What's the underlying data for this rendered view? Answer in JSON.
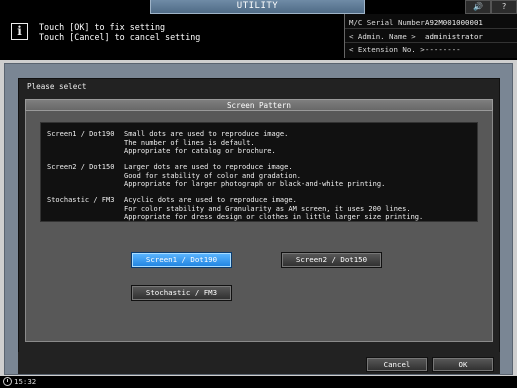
{
  "header": {
    "tab_title": "UTILITY",
    "volume_glyph": "🔊",
    "help_glyph": "?",
    "message_line1": "Touch [OK] to fix setting",
    "message_line2": "Touch [Cancel] to cancel setting"
  },
  "serial_panel": {
    "serial_label": "M/C Serial Number",
    "serial_value": "A92M001000001",
    "admin_label": "< Admin. Name >",
    "admin_value": "administrator",
    "extension_label": "< Extension No. >",
    "extension_value": "--------"
  },
  "dialog": {
    "prompt": "Please select",
    "section_title": "Screen Pattern",
    "descriptions": [
      {
        "name": "Screen1 / Dot190",
        "lines": [
          "Small dots are used to reproduce image.",
          "The number of lines is default.",
          "Appropriate for catalog or brochure."
        ]
      },
      {
        "name": "Screen2 / Dot150",
        "lines": [
          "Larger dots are used to reproduce image.",
          "Good for stability of color and gradation.",
          "Appropriate for larger photograph or black-and-white printing."
        ]
      },
      {
        "name": "Stochastic / FM3",
        "lines": [
          "Acyclic dots are used to reproduce image.",
          "For color stability and Granularity as AM screen, it uses 200 lines.",
          "Appropriate for dress design or clothes in little larger size printing."
        ]
      }
    ],
    "options": {
      "screen1": "Screen1 / Dot190",
      "screen2": "Screen2 / Dot150",
      "stochastic": "Stochastic / FM3"
    },
    "selected_option": "Screen1 / Dot190",
    "cancel_label": "Cancel",
    "ok_label": "OK"
  },
  "status": {
    "time": "15:32"
  },
  "colors": {
    "selected_button": "#1e82e0",
    "frame": "#7a8694",
    "header_tab": "#5b7792"
  },
  "icons": [
    "info-icon",
    "volume-icon",
    "help-icon",
    "clock-icon"
  ]
}
